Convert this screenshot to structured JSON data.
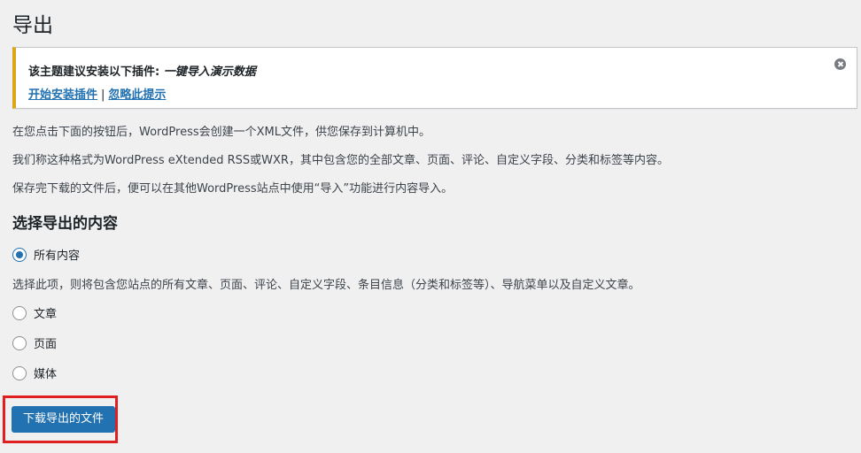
{
  "page": {
    "title": "导出"
  },
  "notice": {
    "message_prefix": "该主题建议安装以下插件: ",
    "plugin_name": "一键导入演示数据",
    "install_link": "开始安装插件",
    "separator": "|",
    "dismiss_link": "忽略此提示"
  },
  "intro": {
    "line1": "在您点击下面的按钮后，WordPress会创建一个XML文件，供您保存到计算机中。",
    "line2": "我们称这种格式为WordPress eXtended RSS或WXR，其中包含您的全部文章、页面、评论、自定义字段、分类和标签等内容。",
    "line3": "保存完下载的文件后，便可以在其他WordPress站点中使用“导入”功能进行内容导入。"
  },
  "section": {
    "heading": "选择导出的内容"
  },
  "options": {
    "all": {
      "label": "所有内容",
      "checked": true
    },
    "all_description": "选择此项，则将包含您站点的所有文章、页面、评论、自定义字段、条目信息（分类和标签等）、导航菜单以及自定义文章。",
    "posts": {
      "label": "文章",
      "checked": false
    },
    "pages": {
      "label": "页面",
      "checked": false
    },
    "media": {
      "label": "媒体",
      "checked": false
    }
  },
  "actions": {
    "download_label": "下载导出的文件"
  },
  "colors": {
    "primary": "#2271b1",
    "notice_warning": "#dba617",
    "highlight": "#e02020"
  }
}
